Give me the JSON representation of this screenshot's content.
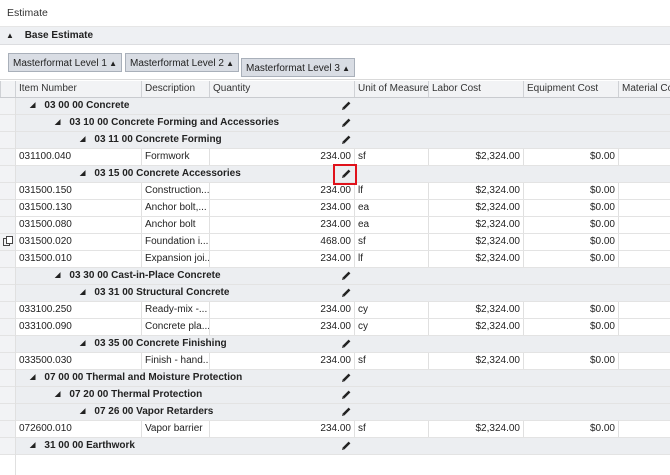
{
  "window": {
    "title": "Estimate"
  },
  "section": {
    "label": "Base Estimate"
  },
  "grouping_chips": [
    {
      "label": "Masterformat Level 1"
    },
    {
      "label": "Masterformat Level 2"
    },
    {
      "label": "Masterformat Level 3"
    }
  ],
  "columns": {
    "item_number": "Item Number",
    "description": "Description",
    "quantity": "Quantity",
    "unit_of_measure": "Unit of Measure",
    "labor_cost": "Labor Cost",
    "equipment_cost": "Equipment Cost",
    "material_cost": "Material Cost"
  },
  "rows": [
    {
      "type": "group",
      "level": 1,
      "label": "03 00 00 Concrete"
    },
    {
      "type": "group",
      "level": 2,
      "label": "03 10 00 Concrete Forming and Accessories"
    },
    {
      "type": "group",
      "level": 3,
      "label": "03 11 00 Concrete Forming"
    },
    {
      "type": "item",
      "item": "031100.040",
      "desc": "Formwork",
      "qty": "234.00",
      "uom": "sf",
      "labor": "$2,324.00",
      "equip": "$0.00"
    },
    {
      "type": "group",
      "level": 3,
      "label": "03 15 00 Concrete Accessories"
    },
    {
      "type": "item",
      "item": "031500.150",
      "desc": "Construction...",
      "qty": "234.00",
      "uom": "lf",
      "labor": "$2,324.00",
      "equip": "$0.00"
    },
    {
      "type": "item",
      "item": "031500.130",
      "desc": "Anchor bolt,...",
      "qty": "234.00",
      "uom": "ea",
      "labor": "$2,324.00",
      "equip": "$0.00"
    },
    {
      "type": "item",
      "item": "031500.080",
      "desc": "Anchor bolt",
      "qty": "234.00",
      "uom": "ea",
      "labor": "$2,324.00",
      "equip": "$0.00"
    },
    {
      "type": "item",
      "item": "031500.020",
      "desc": "Foundation i...",
      "qty": "468.00",
      "uom": "sf",
      "labor": "$2,324.00",
      "equip": "$0.00"
    },
    {
      "type": "item",
      "item": "031500.010",
      "desc": "Expansion joi...",
      "qty": "234.00",
      "uom": "lf",
      "labor": "$2,324.00",
      "equip": "$0.00"
    },
    {
      "type": "group",
      "level": 2,
      "label": "03 30 00 Cast-in-Place Concrete"
    },
    {
      "type": "group",
      "level": 3,
      "label": "03 31 00 Structural Concrete"
    },
    {
      "type": "item",
      "item": "033100.250",
      "desc": "Ready-mix -...",
      "qty": "234.00",
      "uom": "cy",
      "labor": "$2,324.00",
      "equip": "$0.00"
    },
    {
      "type": "item",
      "item": "033100.090",
      "desc": "Concrete pla...",
      "qty": "234.00",
      "uom": "cy",
      "labor": "$2,324.00",
      "equip": "$0.00"
    },
    {
      "type": "group",
      "level": 3,
      "label": "03 35 00 Concrete Finishing"
    },
    {
      "type": "item",
      "item": "033500.030",
      "desc": "Finish - hand...",
      "qty": "234.00",
      "uom": "sf",
      "labor": "$2,324.00",
      "equip": "$0.00"
    },
    {
      "type": "group",
      "level": 1,
      "label": "07 00 00 Thermal and Moisture Protection"
    },
    {
      "type": "group",
      "level": 2,
      "label": "07 20 00 Thermal Protection"
    },
    {
      "type": "group",
      "level": 3,
      "label": "07 26 00 Vapor Retarders"
    },
    {
      "type": "item",
      "item": "072600.010",
      "desc": "Vapor barrier",
      "qty": "234.00",
      "uom": "sf",
      "labor": "$2,324.00",
      "equip": "$0.00"
    },
    {
      "type": "group",
      "level": 1,
      "label": "31 00 00 Earthwork"
    }
  ],
  "icons": {
    "pencil": "pencil-edit-icon",
    "copy": "copy-icon",
    "collapse": "collapse-triangle-icon"
  },
  "colors": {
    "highlight": "#e0121b",
    "group_row": "#eceef1",
    "chip_bg": "#d9dde4"
  }
}
